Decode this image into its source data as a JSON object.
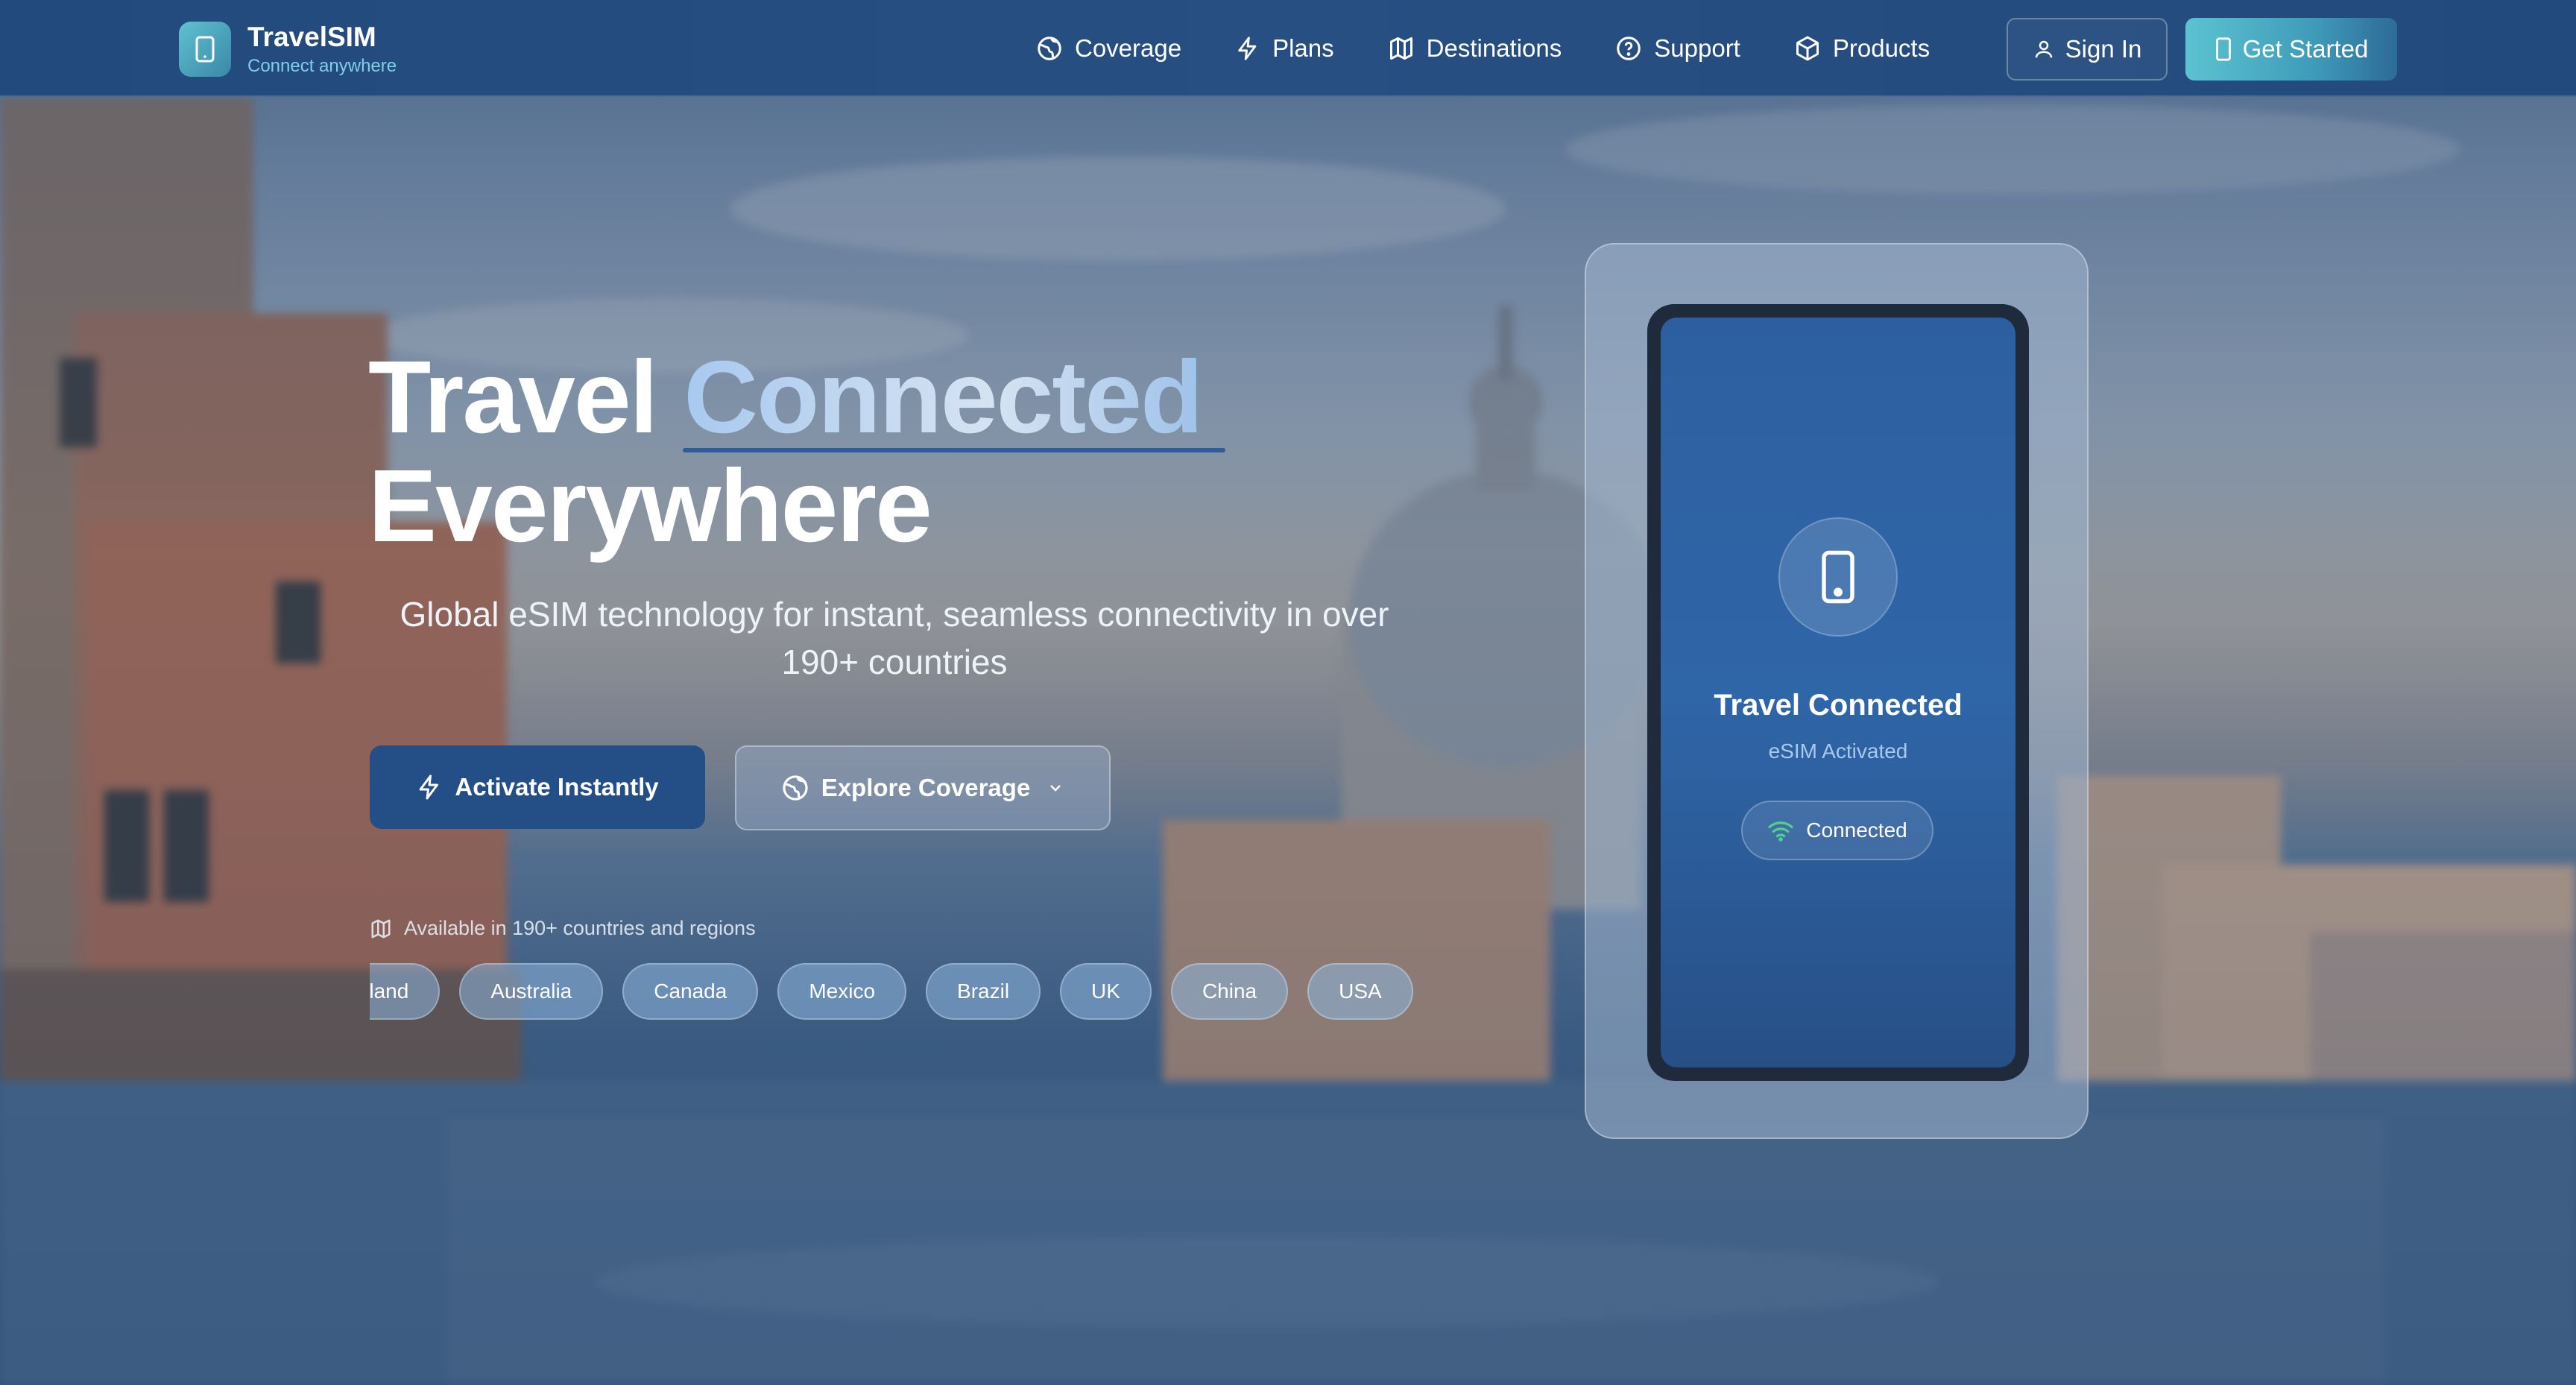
{
  "brand": {
    "name": "TravelSIM",
    "tagline": "Connect anywhere"
  },
  "nav": {
    "items": [
      {
        "label": "Coverage",
        "icon": "globe-icon"
      },
      {
        "label": "Plans",
        "icon": "lightning-icon"
      },
      {
        "label": "Destinations",
        "icon": "map-icon"
      },
      {
        "label": "Support",
        "icon": "help-circle-icon"
      },
      {
        "label": "Products",
        "icon": "box-icon"
      }
    ],
    "sign_in": "Sign In",
    "get_started": "Get Started"
  },
  "hero": {
    "title_part1": "Travel",
    "title_accent": "Connected",
    "title_part2": "Everywhere",
    "subtitle": "Global eSIM technology for instant, seamless connectivity in over 190+ countries",
    "activate_label": "Activate Instantly",
    "explore_label": "Explore Coverage",
    "availability": "Available in 190+ countries and regions",
    "countries": [
      "Iceland",
      "Australia",
      "Canada",
      "Mexico",
      "Brazil",
      "UK",
      "China",
      "USA"
    ]
  },
  "phone": {
    "title": "Travel Connected",
    "subtitle": "eSIM Activated",
    "status": "Connected"
  },
  "colors": {
    "nav_bg": "#234a7c",
    "accent_teal": "#5cc3d1",
    "primary_button": "#234e86",
    "status_green": "#4fd18b"
  }
}
